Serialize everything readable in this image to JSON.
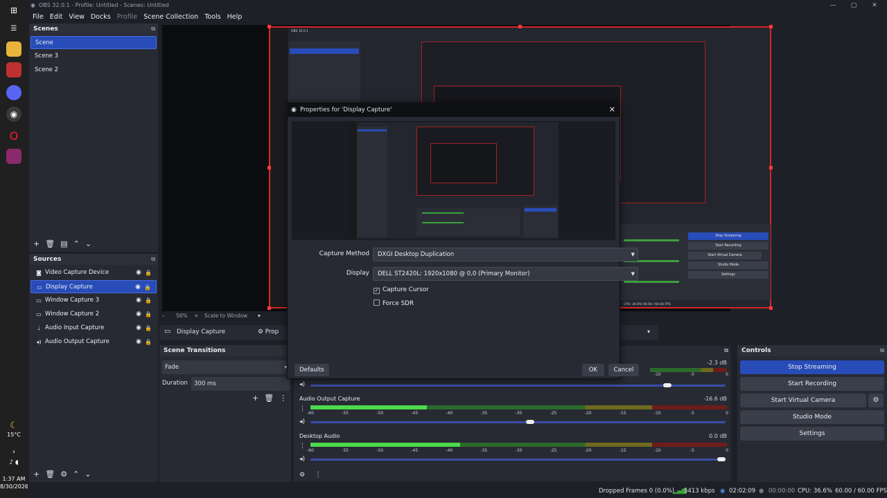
{
  "taskbar": {
    "weather": "15°C",
    "time": "1:37 AM",
    "date": "8/30/2026"
  },
  "window": {
    "title": "OBS 32.0.1 - Profile: Untitled - Scenes: Untitled"
  },
  "menu": [
    "File",
    "Edit",
    "View",
    "Docks",
    "Profile",
    "Scene Collection",
    "Tools",
    "Help"
  ],
  "scenes": {
    "title": "Scenes",
    "items": [
      {
        "label": "Scene",
        "selected": true
      },
      {
        "label": "Scene 3",
        "selected": false
      },
      {
        "label": "Scene 2",
        "selected": false
      }
    ]
  },
  "sources": {
    "title": "Sources",
    "items": [
      {
        "label": "Video Capture Device",
        "icon": "camera-icon",
        "selected": false
      },
      {
        "label": "Display Capture",
        "icon": "monitor-icon",
        "selected": true
      },
      {
        "label": "Window Capture 3",
        "icon": "window-icon",
        "selected": false
      },
      {
        "label": "Window Capture 2",
        "icon": "window-icon",
        "selected": false
      },
      {
        "label": "Audio Input Capture",
        "icon": "microphone-icon",
        "selected": false
      },
      {
        "label": "Audio Output Capture",
        "icon": "speaker-icon",
        "selected": false
      }
    ]
  },
  "preview_toolbar": {
    "zoom": "56%",
    "scale_mode": "Scale to Window"
  },
  "source_toolbar": {
    "source_name": "Display Capture",
    "properties_label": "Prop"
  },
  "scene_transitions": {
    "title": "Scene Transitions",
    "transition": "Fade",
    "duration_label": "Duration",
    "duration_value": "300 ms"
  },
  "properties_dialog": {
    "title": "Properties for 'Display Capture'",
    "capture_method_label": "Capture Method",
    "capture_method_value": "DXGI Desktop Duplication",
    "display_label": "Display",
    "display_value": "DELL ST2420L: 1920x1080 @ 0,0 (Primary Monitor)",
    "capture_cursor_label": "Capture Cursor",
    "capture_cursor_checked": true,
    "force_sdr_label": "Force SDR",
    "force_sdr_checked": false,
    "defaults_label": "Defaults",
    "ok_label": "OK",
    "cancel_label": "Cancel"
  },
  "audio_mixer": {
    "scale_labels": [
      "-60",
      "-55",
      "-50",
      "-45",
      "-40",
      "-35",
      "-30",
      "-25",
      "-20",
      "-15",
      "-10",
      "-5",
      "0"
    ],
    "channels": [
      {
        "name": "",
        "db": "-2.3 dB",
        "level": 0.0,
        "volume": 0.86
      },
      {
        "name": "Audio Output Capture",
        "db": "-16.6 dB",
        "level": 0.28,
        "volume": 0.53
      },
      {
        "name": "Desktop Audio",
        "db": "0.0 dB",
        "level": 0.36,
        "volume": 0.99
      }
    ]
  },
  "controls": {
    "title": "Controls",
    "stop_streaming": "Stop Streaming",
    "start_recording": "Start Recording",
    "start_virtual_camera": "Start Virtual Camera",
    "studio_mode": "Studio Mode",
    "settings": "Settings"
  },
  "status": {
    "dropped_frames": "Dropped Frames 0 (0.0%)",
    "bitrate": "5413 kbps",
    "stream_time": "02:02:09",
    "record_time": "00:00:00",
    "cpu": "CPU: 36.6%",
    "fps": "60.00 / 60.00 FPS"
  },
  "colors": {
    "accent": "#284cb8",
    "source_outline": "#d92626"
  }
}
